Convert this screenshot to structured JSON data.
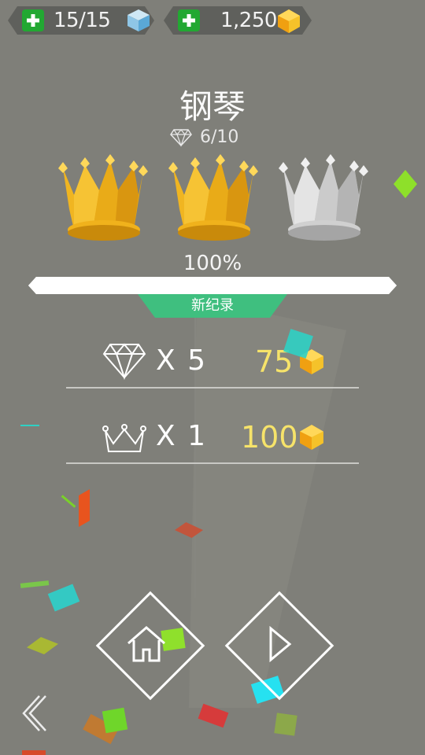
{
  "hud": {
    "energy": "15/15",
    "gems": "1,250"
  },
  "level": {
    "title": "钢琴",
    "diamond_progress": "6/10",
    "crowns_earned": 2,
    "crowns_total": 3,
    "percent_label": "100%",
    "percent_value": 100,
    "record_badge": "新纪录"
  },
  "rewards": [
    {
      "icon": "diamond-outline-icon",
      "multiplier": "X 5",
      "amount": "75"
    },
    {
      "icon": "crown-outline-icon",
      "multiplier": "X 1",
      "amount": "100"
    }
  ],
  "colors": {
    "background": "#7f7f79",
    "gold": "#f0b21c",
    "silver": "#c9c9c9",
    "badge_green": "#3fbf7f",
    "amount_yellow": "#f6e36a"
  }
}
